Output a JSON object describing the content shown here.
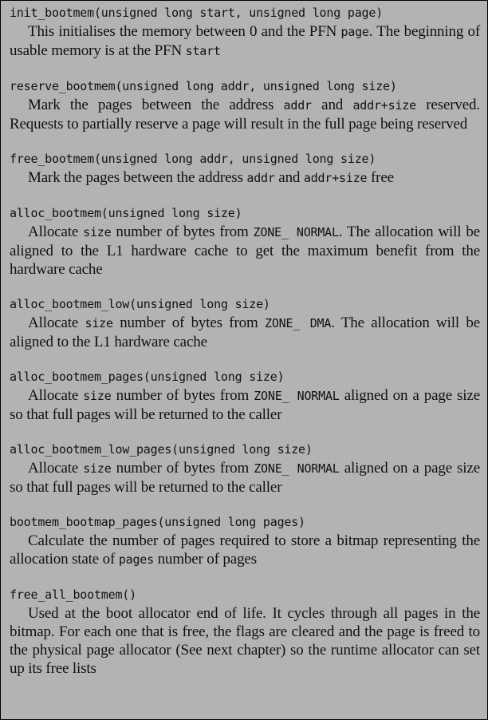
{
  "entries": [
    {
      "signature": "init_bootmem(unsigned long start, unsigned long page)",
      "description": [
        {
          "t": "This initialises the memory between 0 and the PFN "
        },
        {
          "c": "page"
        },
        {
          "t": ". The beginning of usable memory is at the PFN "
        },
        {
          "c": "start"
        }
      ]
    },
    {
      "signature": "reserve_bootmem(unsigned long addr, unsigned long size)",
      "description": [
        {
          "t": "Mark the pages between the address "
        },
        {
          "c": "addr"
        },
        {
          "t": " and "
        },
        {
          "c": "addr+size"
        },
        {
          "t": " reserved. Requests to partially reserve a page will result in the full page being reserved"
        }
      ]
    },
    {
      "signature": "free_bootmem(unsigned long addr, unsigned long size)",
      "description": [
        {
          "t": "Mark the pages between the address "
        },
        {
          "c": "addr"
        },
        {
          "t": " and "
        },
        {
          "c": "addr+size"
        },
        {
          "t": " free"
        }
      ]
    },
    {
      "signature": "alloc_bootmem(unsigned long size)",
      "description": [
        {
          "t": "Allocate "
        },
        {
          "c": "size"
        },
        {
          "t": " number of bytes from "
        },
        {
          "c": "ZONE_ NORMAL"
        },
        {
          "t": ". The allocation will be aligned to the L1 hardware cache to get the maximum benefit from the hardware cache"
        }
      ]
    },
    {
      "signature": "alloc_bootmem_low(unsigned long size)",
      "description": [
        {
          "t": "Allocate "
        },
        {
          "c": "size"
        },
        {
          "t": " number of bytes from "
        },
        {
          "c": "ZONE_ DMA"
        },
        {
          "t": ". The allocation will be aligned to the L1 hardware cache"
        }
      ]
    },
    {
      "signature": "alloc_bootmem_pages(unsigned long size)",
      "description": [
        {
          "t": "Allocate "
        },
        {
          "c": "size"
        },
        {
          "t": " number of bytes from "
        },
        {
          "c": "ZONE_ NORMAL"
        },
        {
          "t": " aligned on a page size so that full pages will be returned to the caller"
        }
      ]
    },
    {
      "signature": "alloc_bootmem_low_pages(unsigned long size)",
      "description": [
        {
          "t": "Allocate "
        },
        {
          "c": "size"
        },
        {
          "t": " number of bytes from "
        },
        {
          "c": "ZONE_ NORMAL"
        },
        {
          "t": " aligned on a page size so that full pages will be returned to the caller"
        }
      ]
    },
    {
      "signature": "bootmem_bootmap_pages(unsigned long pages)",
      "description": [
        {
          "t": "Calculate the number of pages required to store a bitmap representing the allocation state of "
        },
        {
          "c": "pages"
        },
        {
          "t": " number of pages"
        }
      ]
    },
    {
      "signature": "free_all_bootmem()",
      "description": [
        {
          "t": "Used at the boot allocator end of life. It cycles through all pages in the bitmap. For each one that is free, the flags are cleared and the page is freed to the physical page allocator (See next chapter) so the runtime allocator can set up its free lists"
        }
      ]
    }
  ]
}
